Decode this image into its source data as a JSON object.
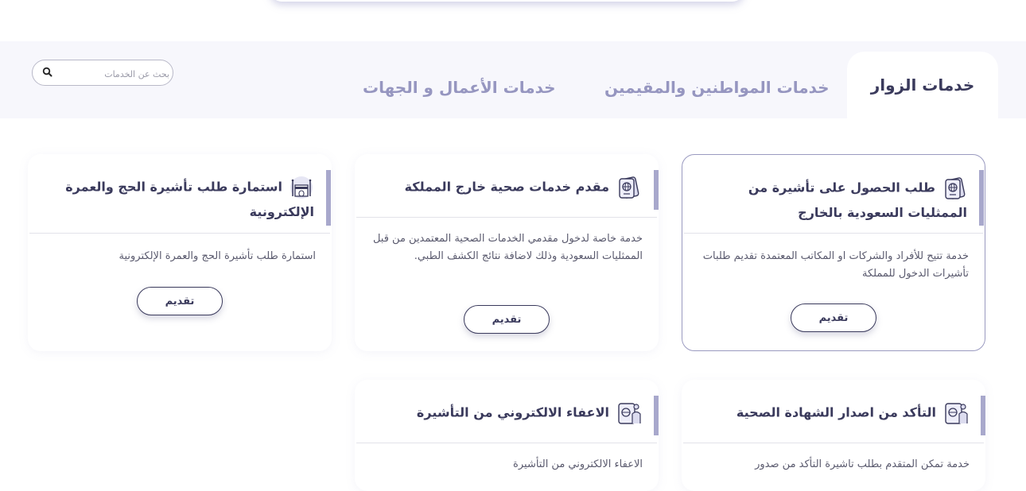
{
  "tabs": {
    "visitors": "خدمات الزوار",
    "citizens": "خدمات المواطنين والمقيمين",
    "business": "خدمات الأعمال و الجهات"
  },
  "search": {
    "placeholder": "بحث عن الخدمات"
  },
  "cards": [
    {
      "title": "طلب الحصول على تأشيرة من الممثليات السعودية بالخارج",
      "description": "خدمة تتيح للأفراد والشركات او المكاتب المعتمدة تقديم طلبات تأشيرات الدخول للمملكة",
      "button": "تقديم",
      "icon": "passport-icon"
    },
    {
      "title": "مقدم خدمات صحية خارج المملكة",
      "description": "خدمة خاصة لدخول مقدمي الخدمات الصحية المعتمدين من قبل الممثليات السعودية وذلك لاضافة نتائج الكشف الطبي.",
      "button": "تقديم",
      "icon": "passport-icon"
    },
    {
      "title": "استمارة طلب تأشيرة الحج والعمرة الإلكترونية",
      "description": "استمارة طلب تأشيرة الحج والعمرة الإلكترونية",
      "button": "تقديم",
      "icon": "kaaba-icon"
    },
    {
      "title": "التأكد من اصدار الشهادة الصحية",
      "description": "خدمة تمكن المتقدم بطلب تاشيرة التأكد من صدور",
      "icon": "person-passport-icon"
    },
    {
      "title": "الاعفاء الالكتروني من التأشيرة",
      "description": "الاعفاء الالكتروني من التأشيرة",
      "icon": "person-passport-icon"
    }
  ],
  "colors": {
    "accent": "#a8a8cc",
    "text": "#3a3a5c",
    "tab_inactive": "#9696c0"
  }
}
